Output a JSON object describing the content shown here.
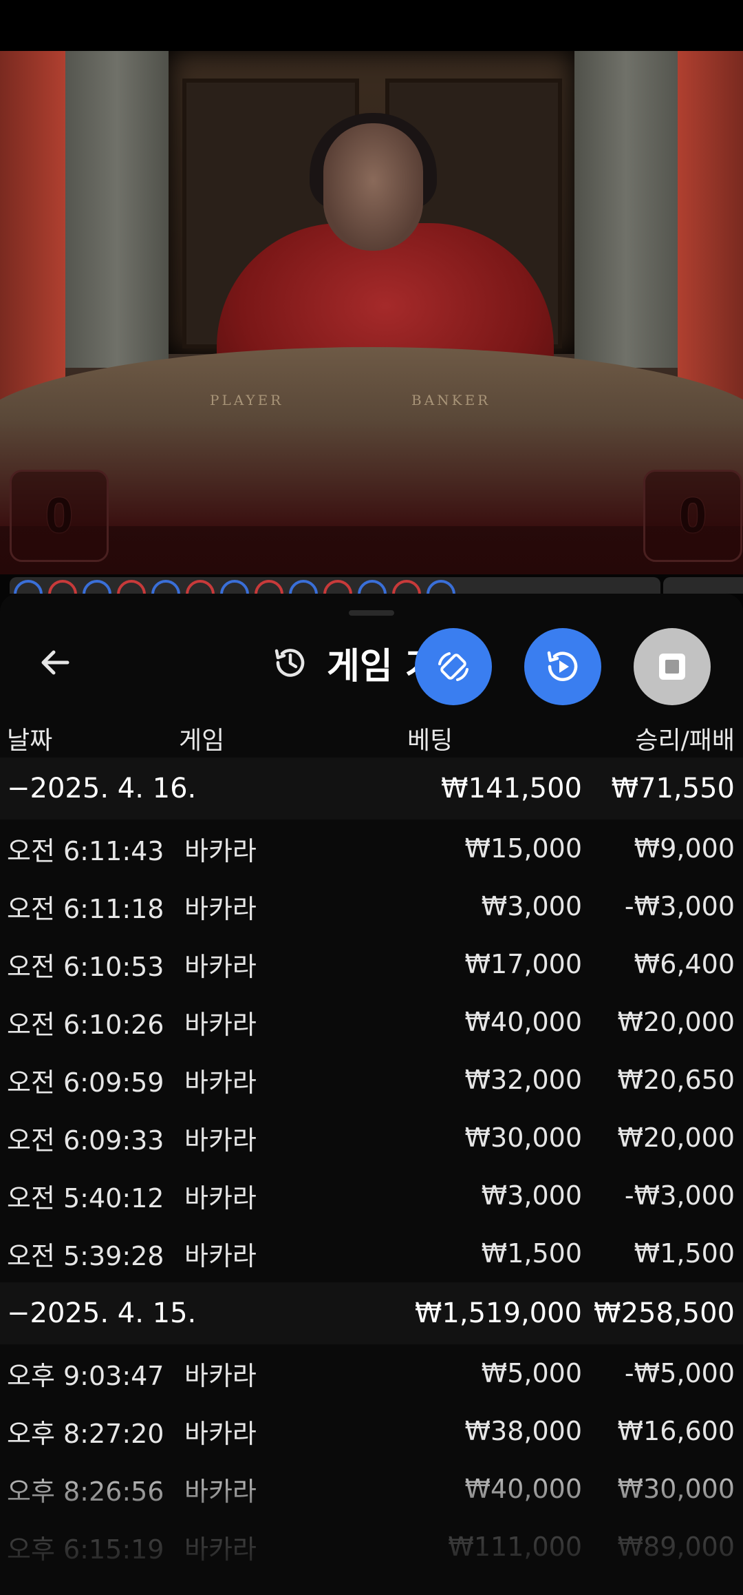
{
  "header": {
    "title": "게임 기록",
    "columns": {
      "date": "날짜",
      "game": "게임",
      "bet": "베팅",
      "result": "승리/패배"
    }
  },
  "video": {
    "table_player_label": "PLAYER",
    "table_banker_label": "BANKER",
    "player_score": "0",
    "banker_score": "0"
  },
  "colors": {
    "accent_blue": "#3a7ef0",
    "sheet_bg": "#0a0a0a",
    "fab_grey": "#c2c2c2"
  },
  "icons": {
    "back": "arrow-left-icon",
    "history": "history-icon",
    "rotate": "screen-rotate-icon",
    "replay": "replay-icon",
    "stop": "stop-icon"
  },
  "groups": [
    {
      "date": "−2025. 4. 16.",
      "bet_total": "₩141,500",
      "result_total": "₩71,550",
      "rows": [
        {
          "time": "오전 6:11:43",
          "game": "바카라",
          "bet": "₩15,000",
          "result": "₩9,000"
        },
        {
          "time": "오전 6:11:18",
          "game": "바카라",
          "bet": "₩3,000",
          "result": "-₩3,000"
        },
        {
          "time": "오전 6:10:53",
          "game": "바카라",
          "bet": "₩17,000",
          "result": "₩6,400"
        },
        {
          "time": "오전 6:10:26",
          "game": "바카라",
          "bet": "₩40,000",
          "result": "₩20,000"
        },
        {
          "time": "오전 6:09:59",
          "game": "바카라",
          "bet": "₩32,000",
          "result": "₩20,650"
        },
        {
          "time": "오전 6:09:33",
          "game": "바카라",
          "bet": "₩30,000",
          "result": "₩20,000"
        },
        {
          "time": "오전 5:40:12",
          "game": "바카라",
          "bet": "₩3,000",
          "result": "-₩3,000"
        },
        {
          "time": "오전 5:39:28",
          "game": "바카라",
          "bet": "₩1,500",
          "result": "₩1,500"
        }
      ]
    },
    {
      "date": "−2025. 4. 15.",
      "bet_total": "₩1,519,000",
      "result_total": "₩258,500",
      "rows": [
        {
          "time": "오후 9:03:47",
          "game": "바카라",
          "bet": "₩5,000",
          "result": "-₩5,000"
        },
        {
          "time": "오후 8:27:20",
          "game": "바카라",
          "bet": "₩38,000",
          "result": "₩16,600"
        },
        {
          "time": "오후 8:26:56",
          "game": "바카라",
          "bet": "₩40,000",
          "result": "₩30,000"
        },
        {
          "time": "오후 6:15:19",
          "game": "바카라",
          "bet": "₩111,000",
          "result": "₩89,000"
        }
      ]
    }
  ]
}
